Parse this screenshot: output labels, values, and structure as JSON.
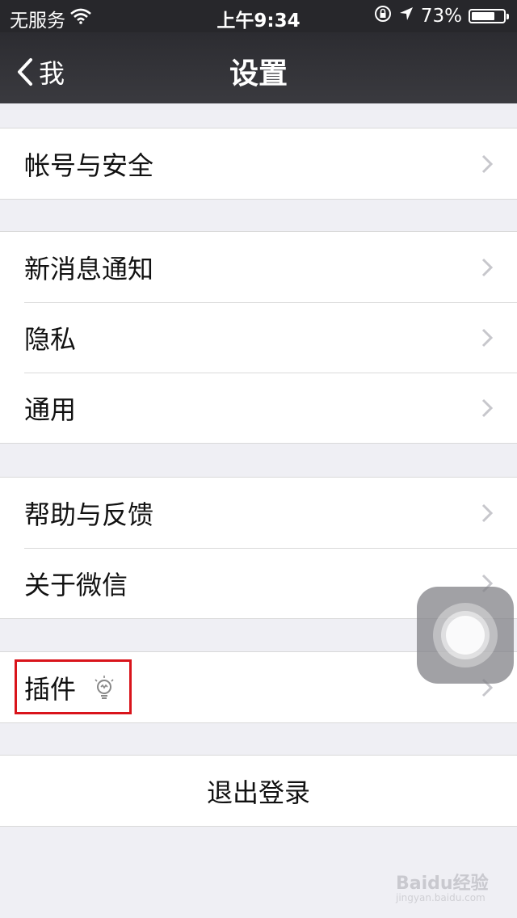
{
  "status_bar": {
    "carrier": "无服务",
    "time": "上午9:34",
    "battery_text": "73%",
    "battery_level": 0.73
  },
  "nav": {
    "back_label": "我",
    "title": "设置"
  },
  "groups": [
    {
      "items": [
        {
          "label": "帐号与安全"
        }
      ]
    },
    {
      "items": [
        {
          "label": "新消息通知"
        },
        {
          "label": "隐私"
        },
        {
          "label": "通用"
        }
      ]
    },
    {
      "items": [
        {
          "label": "帮助与反馈"
        },
        {
          "label": "关于微信"
        }
      ]
    },
    {
      "items": [
        {
          "label": "插件"
        }
      ]
    }
  ],
  "logout": {
    "label": "退出登录"
  },
  "watermark": {
    "brand": "Baidu经验",
    "url": "jingyan.baidu.com"
  },
  "colors": {
    "highlight": "#d9141b",
    "nav_bg": "#2c2c31",
    "page_bg": "#efeff4"
  }
}
